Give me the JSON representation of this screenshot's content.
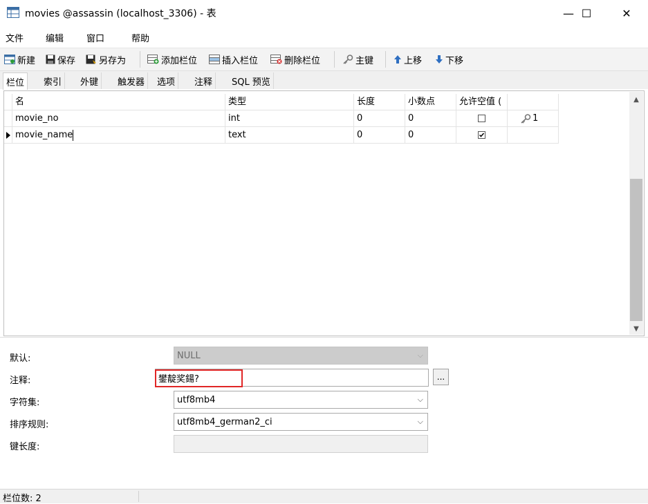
{
  "window": {
    "title": "movies @assassin (localhost_3306) - 表",
    "minimize_glyph": "—",
    "maximize_glyph": "☐",
    "close_glyph": "✕"
  },
  "menu": [
    "文件",
    "编辑",
    "窗口",
    "帮助"
  ],
  "toolbar": {
    "new": "新建",
    "save": "保存",
    "save_as": "另存为",
    "add_field": "添加栏位",
    "insert_field": "插入栏位",
    "delete_field": "删除栏位",
    "primary_key": "主键",
    "move_up": "上移",
    "move_down": "下移"
  },
  "tabs": [
    "栏位",
    "索引",
    "外键",
    "触发器",
    "选项",
    "注释",
    "SQL 预览"
  ],
  "grid": {
    "columns": [
      "名",
      "类型",
      "长度",
      "小数点",
      "允许空值 (",
      ""
    ],
    "rows": [
      {
        "name": "movie_no",
        "type": "int",
        "length": "0",
        "decimals": "0",
        "nullable": false,
        "key": "1"
      },
      {
        "name": "movie_name",
        "type": "text",
        "length": "0",
        "decimals": "0",
        "nullable": true,
        "key": ""
      }
    ]
  },
  "properties": {
    "default_label": "默认:",
    "default_value": "NULL",
    "comment_label": "注释:",
    "comment_value": "鐢靛奖鍚?",
    "ellipsis": "...",
    "charset_label": "字符集:",
    "charset_value": "utf8mb4",
    "collation_label": "排序规则:",
    "collation_value": "utf8mb4_german2_ci",
    "key_length_label": "键长度:",
    "key_length_value": ""
  },
  "status": {
    "field_count": "栏位数: 2"
  },
  "colors": {
    "highlight": "#e02626",
    "toolbar_bg": "#f3f3f3",
    "disabled_bg": "#cccccc"
  }
}
